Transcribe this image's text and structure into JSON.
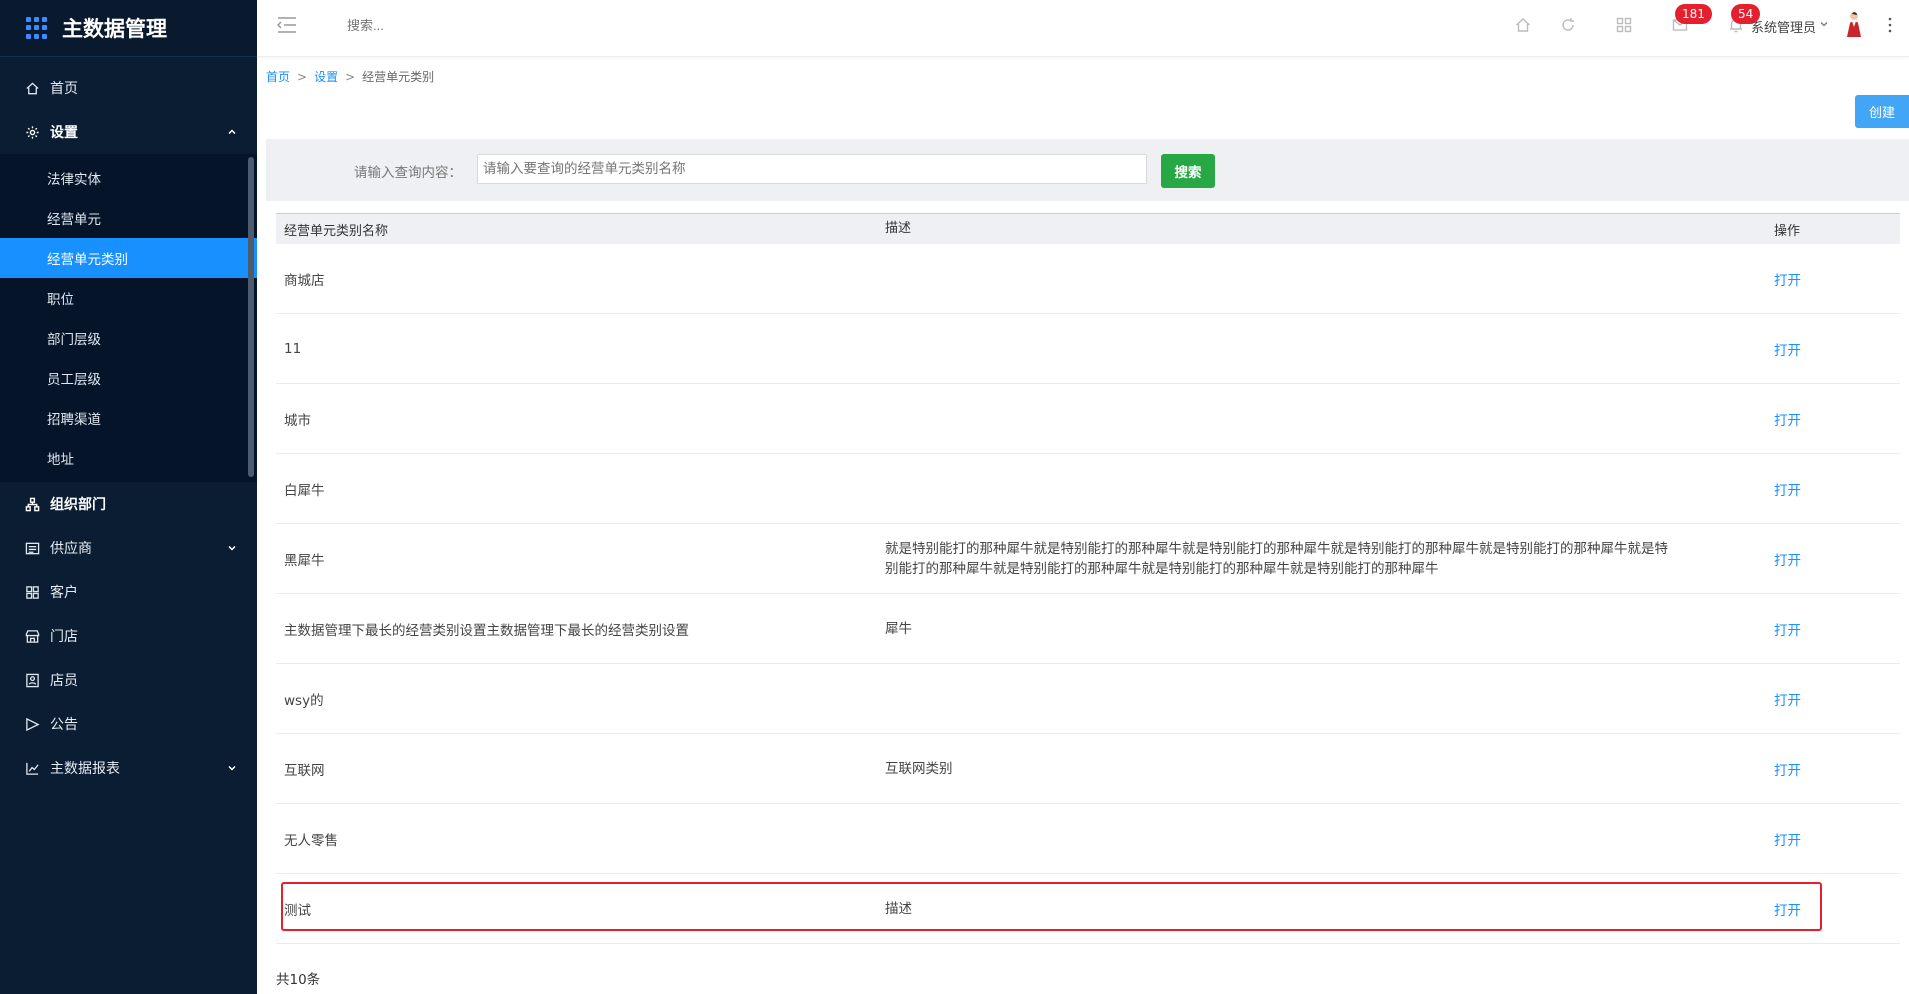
{
  "app": {
    "title": "主数据管理"
  },
  "sidebar": {
    "items": [
      {
        "label": "首页",
        "icon": "home-icon"
      },
      {
        "label": "设置",
        "icon": "gear-icon",
        "expanded": true,
        "children": [
          {
            "label": "法律实体"
          },
          {
            "label": "经营单元"
          },
          {
            "label": "经营单元类别",
            "active": true
          },
          {
            "label": "职位"
          },
          {
            "label": "部门层级"
          },
          {
            "label": "员工层级"
          },
          {
            "label": "招聘渠道"
          },
          {
            "label": "地址"
          }
        ]
      },
      {
        "label": "组织部门",
        "icon": "org-chart-icon"
      },
      {
        "label": "供应商",
        "icon": "supplier-icon"
      },
      {
        "label": "客户",
        "icon": "customer-icon"
      },
      {
        "label": "门店",
        "icon": "store-icon"
      },
      {
        "label": "店员",
        "icon": "clerk-icon"
      },
      {
        "label": "公告",
        "icon": "announcement-icon"
      },
      {
        "label": "主数据报表",
        "icon": "chart-icon"
      }
    ]
  },
  "topbar": {
    "search_placeholder": "搜索...",
    "mail_badge": "181",
    "notify_badge": "54",
    "user_name": "系统管理员"
  },
  "breadcrumb": {
    "home": "首页",
    "settings": "设置",
    "current": "经营单元类别",
    "sep": ">"
  },
  "toolbar": {
    "create_label": "创建"
  },
  "search": {
    "label": "请输入查询内容：",
    "placeholder": "请输入要查询的经营单元类别名称",
    "button_label": "搜索"
  },
  "table": {
    "headers": {
      "name": "经营单元类别名称",
      "desc": "描述",
      "op": "操作"
    },
    "rows": [
      {
        "name": "商城店",
        "desc": "",
        "op": "打开"
      },
      {
        "name": "11",
        "desc": "",
        "op": "打开"
      },
      {
        "name": "城市",
        "desc": "",
        "op": "打开"
      },
      {
        "name": "白犀牛",
        "desc": "",
        "op": "打开"
      },
      {
        "name": "黑犀牛",
        "desc": "就是特别能打的那种犀牛就是特别能打的那种犀牛就是特别能打的那种犀牛就是特别能打的那种犀牛就是特别能打的那种犀牛就是特别能打的那种犀牛就是特别能打的那种犀牛就是特别能打的那种犀牛就是特别能打的那种犀牛",
        "op": "打开"
      },
      {
        "name": "主数据管理下最长的经营类别设置主数据管理下最长的经营类别设置",
        "desc": "犀牛",
        "op": "打开"
      },
      {
        "name": "wsy的",
        "desc": "",
        "op": "打开"
      },
      {
        "name": "互联网",
        "desc": "互联网类别",
        "op": "打开"
      },
      {
        "name": "无人零售",
        "desc": "",
        "op": "打开"
      },
      {
        "name": "测试",
        "desc": "描述",
        "op": "打开"
      }
    ],
    "total": "共10条"
  },
  "colors": {
    "sidebar_bg": "#0b1d33",
    "active": "#1890ff",
    "search_button": "#28a745",
    "badge": "#e5202e"
  }
}
